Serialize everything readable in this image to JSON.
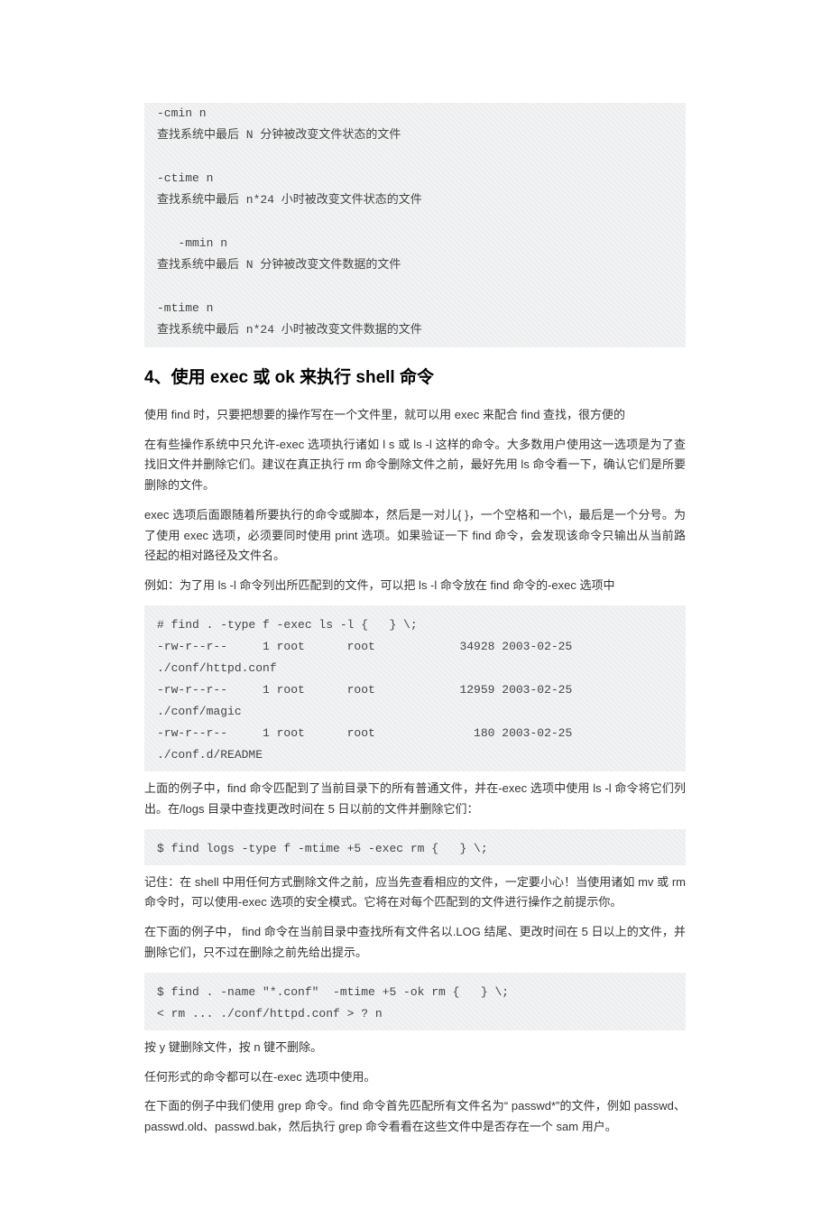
{
  "code1": "-cmin n\n查找系统中最后 N 分钟被改变文件状态的文件\n\n-ctime n\n查找系统中最后 n*24 小时被改变文件状态的文件\n\n   -mmin n\n查找系统中最后 N 分钟被改变文件数据的文件\n\n-mtime n\n查找系统中最后 n*24 小时被改变文件数据的文件",
  "heading": "4、使用 exec 或 ok 来执行 shell 命令",
  "p1": "使用 find 时，只要把想要的操作写在一个文件里，就可以用 exec 来配合 find 查找，很方便的",
  "p2": "在有些操作系统中只允许-exec 选项执行诸如 l s 或 ls -l 这样的命令。大多数用户使用这一选项是为了查找旧文件并删除它们。建议在真正执行 rm 命令删除文件之前，最好先用 ls 命令看一下，确认它们是所要删除的文件。",
  "p3": "exec 选项后面跟随着所要执行的命令或脚本，然后是一对儿{ }，一个空格和一个\\，最后是一个分号。为了使用 exec 选项，必须要同时使用 print 选项。如果验证一下 find 命令，会发现该命令只输出从当前路径起的相对路径及文件名。",
  "p4": "例如：为了用 ls -l 命令列出所匹配到的文件，可以把 ls -l 命令放在 find 命令的-exec 选项中",
  "code2": "# find . -type f -exec ls -l {   } \\;\n-rw-r--r--     1 root      root            34928 2003-02-25   ./conf/httpd.conf\n-rw-r--r--     1 root      root            12959 2003-02-25   ./conf/magic\n-rw-r--r--     1 root      root              180 2003-02-25   ./conf.d/README",
  "p5": "上面的例子中，find 命令匹配到了当前目录下的所有普通文件，并在-exec 选项中使用 ls -l 命令将它们列出。在/logs 目录中查找更改时间在 5 日以前的文件并删除它们：",
  "code3": "$ find logs -type f -mtime +5 -exec rm {   } \\;",
  "p6": "记住：在 shell 中用任何方式删除文件之前，应当先查看相应的文件，一定要小心！当使用诸如 mv 或 rm 命令时，可以使用-exec 选项的安全模式。它将在对每个匹配到的文件进行操作之前提示你。",
  "p7": "在下面的例子中， find 命令在当前目录中查找所有文件名以.LOG 结尾、更改时间在 5 日以上的文件，并删除它们，只不过在删除之前先给出提示。",
  "code4": "$ find . -name \"*.conf\"  -mtime +5 -ok rm {   } \\;\n< rm ... ./conf/httpd.conf > ? n",
  "p8": "按 y 键删除文件，按 n 键不删除。",
  "p9": "任何形式的命令都可以在-exec 选项中使用。",
  "p10": "在下面的例子中我们使用 grep 命令。find 命令首先匹配所有文件名为“ passwd*”的文件，例如 passwd、passwd.old、passwd.bak，然后执行 grep 命令看看在这些文件中是否存在一个 sam 用户。"
}
